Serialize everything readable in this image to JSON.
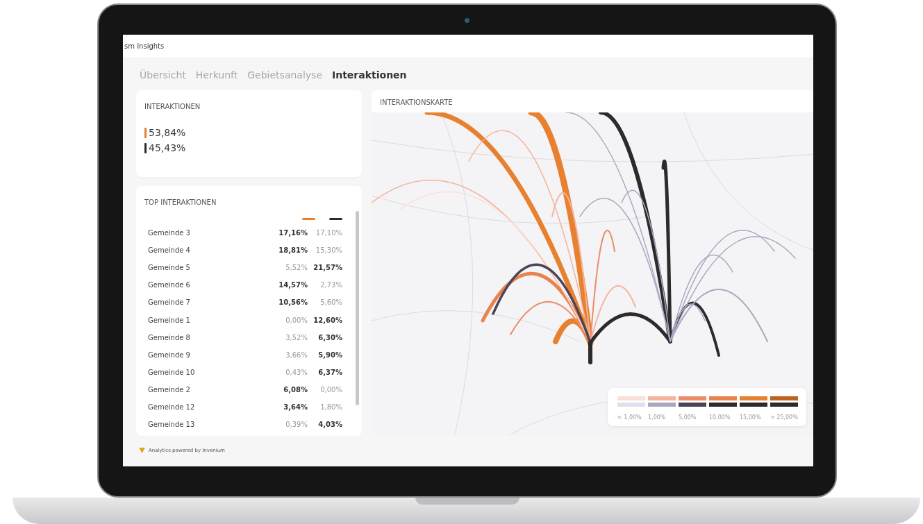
{
  "app": {
    "title": "sm Insights"
  },
  "tabs": [
    {
      "label": "Übersicht",
      "selected": false
    },
    {
      "label": "Herkunft",
      "selected": false
    },
    {
      "label": "Gebietsanalyse",
      "selected": false
    },
    {
      "label": "Interaktionen",
      "selected": true
    }
  ],
  "summary": {
    "title": "INTERAKTIONEN",
    "items": [
      {
        "value": "53,84%",
        "color": "#e8812f"
      },
      {
        "value": "45,43%",
        "color": "#2f2b2e"
      }
    ]
  },
  "top": {
    "title": "TOP INTERAKTIONEN",
    "series": [
      {
        "color": "#e8812f"
      },
      {
        "color": "#2f2b2e"
      }
    ],
    "rows": [
      {
        "name": "Gemeinde 3",
        "a": "17,16%",
        "b": "17,10%",
        "a_bold": true,
        "b_bold": false
      },
      {
        "name": "Gemeinde 4",
        "a": "18,81%",
        "b": "15,30%",
        "a_bold": true,
        "b_bold": false
      },
      {
        "name": "Gemeinde 5",
        "a": "5,52%",
        "b": "21,57%",
        "a_bold": false,
        "b_bold": true
      },
      {
        "name": "Gemeinde 6",
        "a": "14,57%",
        "b": "2,73%",
        "a_bold": true,
        "b_bold": false
      },
      {
        "name": "Gemeinde 7",
        "a": "10,56%",
        "b": "5,60%",
        "a_bold": true,
        "b_bold": false
      },
      {
        "name": "Gemeinde 1",
        "a": "0,00%",
        "b": "12,60%",
        "a_bold": false,
        "b_bold": true
      },
      {
        "name": "Gemeinde 8",
        "a": "3,52%",
        "b": "6,30%",
        "a_bold": false,
        "b_bold": true
      },
      {
        "name": "Gemeinde 9",
        "a": "3,66%",
        "b": "5,90%",
        "a_bold": false,
        "b_bold": true
      },
      {
        "name": "Gemeinde 10",
        "a": "0,43%",
        "b": "6,37%",
        "a_bold": false,
        "b_bold": true
      },
      {
        "name": "Gemeinde 2",
        "a": "6,08%",
        "b": "0,00%",
        "a_bold": true,
        "b_bold": false
      },
      {
        "name": "Gemeinde 12",
        "a": "3,64%",
        "b": "1,80%",
        "a_bold": true,
        "b_bold": false
      },
      {
        "name": "Gemeinde 13",
        "a": "0,39%",
        "b": "4,03%",
        "a_bold": false,
        "b_bold": true
      }
    ]
  },
  "map": {
    "title": "INTERAKTIONSKARTE",
    "legend_orange": [
      {
        "color": "#fbe0d8"
      },
      {
        "color": "#f4b49c"
      },
      {
        "color": "#ec8c6a"
      },
      {
        "color": "#e9834c"
      },
      {
        "color": "#e8812f"
      },
      {
        "color": "#c0611e"
      }
    ],
    "legend_dark": [
      {
        "color": "#dfe0ee"
      },
      {
        "color": "#a9a8c0"
      },
      {
        "color": "#4b4358"
      },
      {
        "color": "#2d2a2c"
      },
      {
        "color": "#2d2a2c"
      },
      {
        "color": "#2d2a2c"
      }
    ],
    "legend_labels": [
      "< 1,00%",
      "1,00%",
      "5,00%",
      "10,00%",
      "15,00%",
      "> 25,00%"
    ]
  },
  "footer": {
    "text": "Analytics powered by Invenium"
  }
}
